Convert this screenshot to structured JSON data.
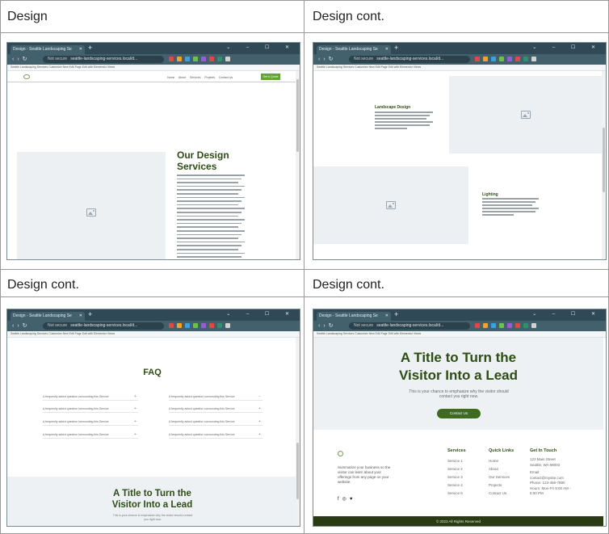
{
  "cells": [
    {
      "title": "Design"
    },
    {
      "title": "Design cont."
    },
    {
      "title": "Design cont."
    },
    {
      "title": "Design cont."
    }
  ],
  "browser": {
    "tab_title": "Design - Seattle Landscaping Se",
    "new_tab": "+",
    "window_controls": "⌄ – ☐ ✕",
    "not_secure": "Not secure",
    "url": "seattle-landscaping-services.local/d...",
    "bookmarks": "Seattle Landscaping Services   Customize   New   Edit Page   Edit with Elementor   Views",
    "ext_colors": [
      "#e04747",
      "#f0a12e",
      "#3aa0e0",
      "#6bc24a",
      "#9c5bd6",
      "#e04747",
      "#2f8f6e",
      "#d2d2d2"
    ]
  },
  "site": {
    "nav": [
      "Home",
      "About",
      "Services",
      "Projects",
      "Contact Us"
    ],
    "nav_cta": "Get A Quote",
    "design_heading": "Our Design Services",
    "landscape_title": "Landscape Design",
    "lighting_title": "Lighting",
    "faq_title": "FAQ",
    "faq_left": [
      "A frequently asked question surrounding this Service",
      "A frequently asked question surrounding this Service",
      "A frequently asked question surrounding this Service",
      "A frequently asked question surrounding this Service"
    ],
    "faq_right": [
      "A frequently asked question surrounding this Service",
      "A frequently asked question surrounding this Service",
      "A frequently asked question surrounding this Service",
      "A frequently asked question surrounding this Service"
    ],
    "cta_title_line1": "A Title to Turn the",
    "cta_title_line2": "Visitor Into a Lead",
    "cta_text": "This is your chance to emphasize why the visitor should contact you right now.",
    "cta_button": "Contact Us",
    "footer_blurb": "Summarize your business so the visitor can learn about your offerings from any page on your website.",
    "services_heading": "Services",
    "services": [
      "Service 1",
      "Service 2",
      "Service 3",
      "Service 4",
      "Service 5"
    ],
    "quick_links_heading": "Quick Links",
    "quick_links": [
      "Home",
      "About",
      "Our Services",
      "Projects",
      "Contact Us"
    ],
    "touch_heading": "Get In Touch",
    "touch_lines": [
      "123 Main Street",
      "Seattle, WA 98003",
      "Email:",
      "contact@mysite.com",
      "Phone: 123-456-7890",
      "Hours: Mon-Fri 9:00 AM -",
      "5:00 PM"
    ],
    "copyright": "© 2023 All Rights Reserved",
    "social_icons": [
      "facebook-icon",
      "instagram-icon",
      "twitter-icon"
    ]
  },
  "colors": {
    "brand_green": "#2d4d14",
    "cta_button": "#3e6b1f",
    "footer_bar": "#2a3a12",
    "chrome": "#2f4a56"
  }
}
